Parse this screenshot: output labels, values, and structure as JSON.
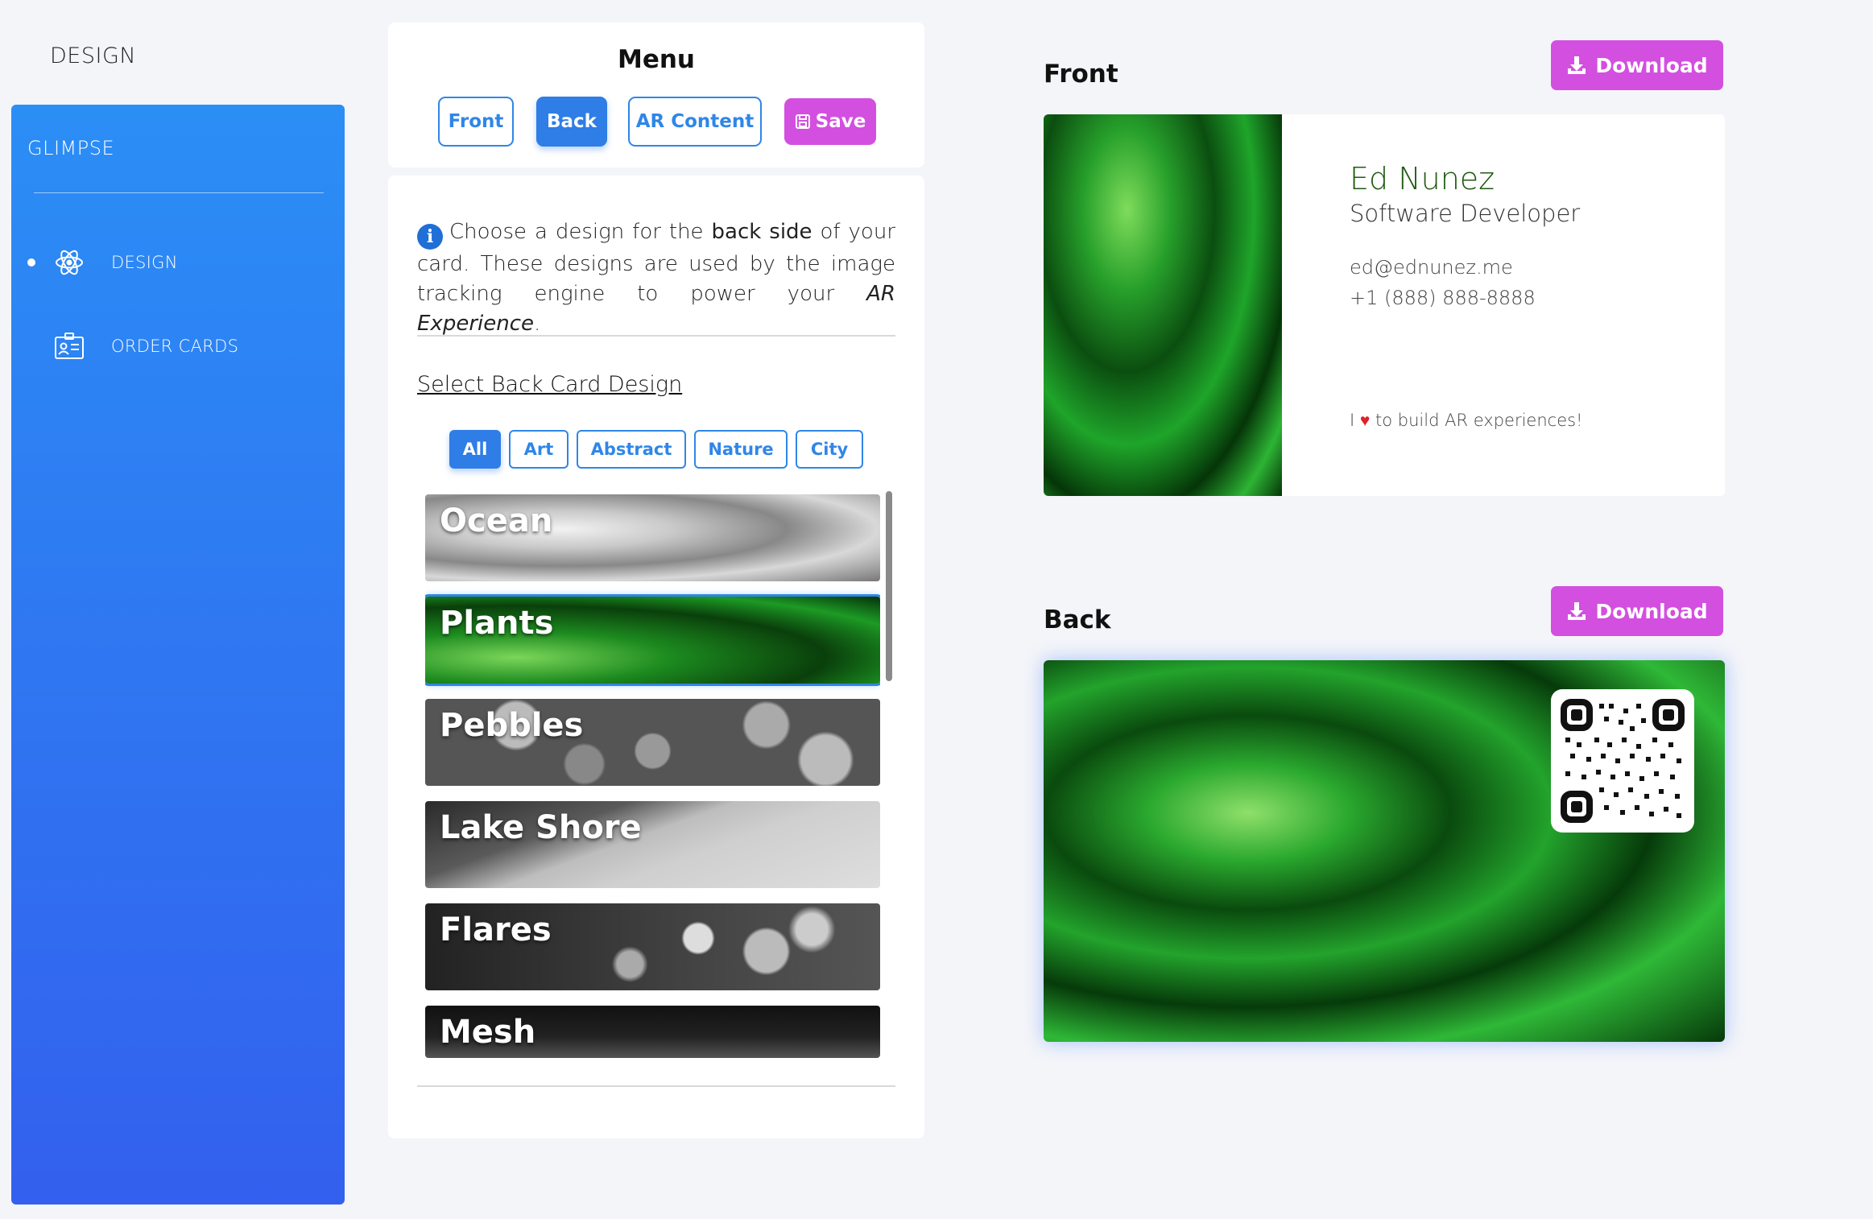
{
  "page": {
    "title": "DESIGN"
  },
  "sidebar": {
    "brand": "GLIMPSE",
    "items": [
      {
        "label": "DESIGN",
        "icon": "atom-icon",
        "active": true
      },
      {
        "label": "ORDER CARDS",
        "icon": "id-card-icon",
        "active": false
      }
    ]
  },
  "menu": {
    "title": "Menu",
    "buttons": {
      "front": "Front",
      "back": "Back",
      "ar_content": "AR Content",
      "save": "Save"
    },
    "active": "Back"
  },
  "design": {
    "info": {
      "part1": "Choose a design for the ",
      "bold": "back side",
      "part2": " of your card. These designs are used by the image tracking engine to power your ",
      "italic": "AR Experience",
      "part3": "."
    },
    "select_title": "Select Back Card Design",
    "filters": [
      "All",
      "Art",
      "Abstract",
      "Nature",
      "City"
    ],
    "active_filter": "All",
    "tiles": [
      "Ocean",
      "Plants",
      "Pebbles",
      "Lake Shore",
      "Flares",
      "Mesh"
    ],
    "selected_tile": "Plants"
  },
  "preview": {
    "front_label": "Front",
    "back_label": "Back",
    "download_label": "Download",
    "card": {
      "name": "Ed Nunez",
      "role": "Software Developer",
      "email": "ed@ednunez.me",
      "phone": "+1 (888) 888-8888",
      "tag_before": "I ",
      "tag_after": " to build AR experiences!"
    }
  },
  "colors": {
    "sidebar_top": "#2b8ef5",
    "sidebar_bottom": "#3360ee",
    "accent": "#2f86e8",
    "download": "#d34fe0"
  }
}
